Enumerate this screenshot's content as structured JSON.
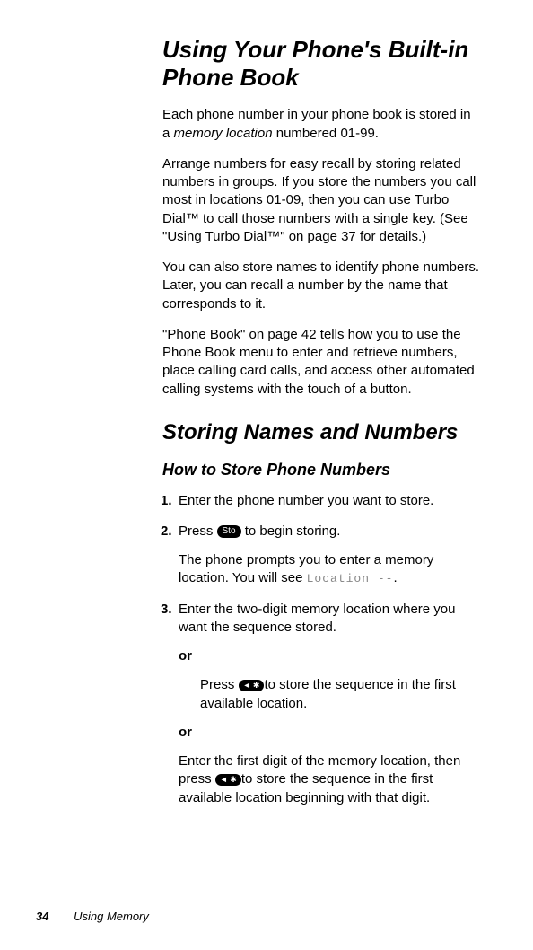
{
  "section1": {
    "heading": "Using Your Phone's Built-in Phone Book",
    "para1a": "Each phone number in your phone book is stored in a ",
    "para1b": "memory location",
    "para1c": " numbered 01-99.",
    "para2": "Arrange numbers for easy recall by storing related numbers in groups. If you store the numbers you call most in locations 01-09, then you can use Turbo Dial™ to call those numbers with a single key. (See \"Using Turbo Dial™\" on page 37 for details.)",
    "para3": "You can also store names to identify phone numbers. Later, you can recall a number by the name that corresponds to it.",
    "para4": "\"Phone Book\" on page 42 tells how you to use the Phone Book menu to enter and retrieve numbers, place calling card calls, and access other automated calling systems with the touch of a button."
  },
  "section2": {
    "heading": "Storing Names and Numbers",
    "subheading": "How to Store Phone Numbers",
    "steps": {
      "s1": {
        "num": "1.",
        "text": "Enter the phone number you want to store."
      },
      "s2": {
        "num": "2.",
        "text_a": "Press",
        "key": "Sto",
        "text_b": " to begin storing.",
        "sub_a": "The phone prompts you to enter a memory location. You will see ",
        "lcd": "Location --",
        "sub_c": "."
      },
      "s3": {
        "num": "3.",
        "text": "Enter the two-digit memory location where you want the sequence stored.",
        "or1": "or",
        "alt1_a": "Press ",
        "alt1_key": "◄ ✱",
        "alt1_b": "to store the sequence in the first available location.",
        "or2": "or",
        "alt2_a": "Enter the first digit of the memory location, then press ",
        "alt2_key": "◄ ✱",
        "alt2_b": "to store the sequence in the first available location beginning with that digit."
      }
    }
  },
  "footer": {
    "page": "34",
    "section": "Using Memory"
  }
}
